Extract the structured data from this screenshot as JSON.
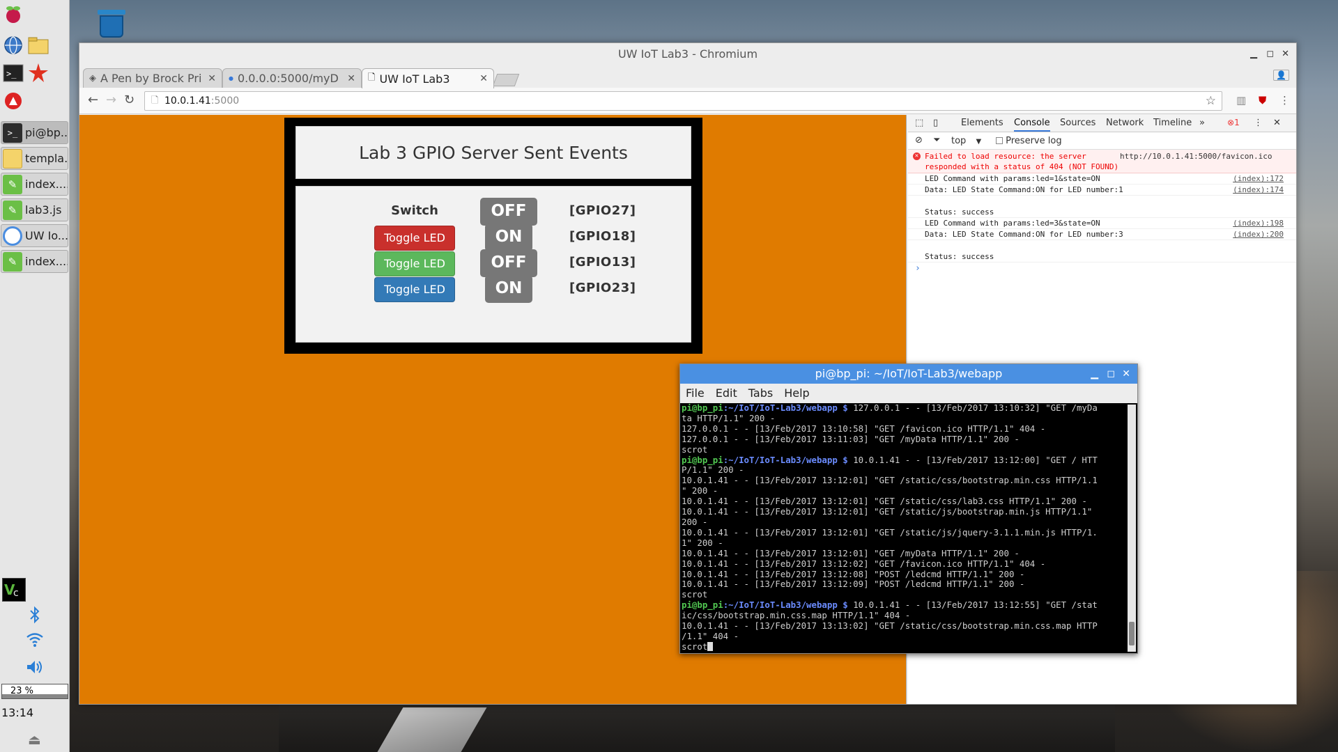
{
  "browser": {
    "window_title": "UW IoT Lab3 - Chromium",
    "tabs": [
      {
        "label": "A Pen by Brock Pri"
      },
      {
        "label": "0.0.0.0:5000/myD"
      },
      {
        "label": "UW IoT Lab3"
      }
    ],
    "url_host": "10.0.1.41",
    "url_port": ":5000"
  },
  "taskbar": {
    "tasks": [
      {
        "label": "pi@bp..."
      },
      {
        "label": "templa..."
      },
      {
        "label": "index...."
      },
      {
        "label": "lab3.js"
      },
      {
        "label": "UW Io..."
      },
      {
        "label": "index...."
      }
    ],
    "cpu": "23 %",
    "clock": "13:14"
  },
  "lab": {
    "title": "Lab 3 GPIO Server Sent Events",
    "switch_label": "Switch",
    "rows": [
      {
        "state": "OFF",
        "gpio": "[GPIO27]"
      },
      {
        "button": "Toggle LED",
        "state": "ON",
        "gpio": "[GPIO18]",
        "color": "#c9302c"
      },
      {
        "button": "Toggle LED",
        "state": "OFF",
        "gpio": "[GPIO13]",
        "color": "#5cb85c"
      },
      {
        "button": "Toggle LED",
        "state": "ON",
        "gpio": "[GPIO23]",
        "color": "#337ab7"
      }
    ]
  },
  "devtools": {
    "tabs": [
      "Elements",
      "Console",
      "Sources",
      "Network",
      "Timeline",
      "»"
    ],
    "error_count": "1",
    "context": "top",
    "preserve_log": "Preserve log",
    "error_text_1": "Failed to load resource: the server",
    "error_text_2": "responded with a status of 404 (NOT FOUND)",
    "error_url": "http://10.0.1.41:5000/favicon.ico",
    "logs": [
      {
        "text": "LED Command with params:led=1&state=ON",
        "src": "(index):172"
      },
      {
        "text": "Data: LED State Command:ON for LED number:1",
        "src": "(index):174"
      },
      {
        "text": "",
        "src": ""
      },
      {
        "text": "Status: success",
        "src": ""
      },
      {
        "text": "LED Command with params:led=3&state=ON",
        "src": "(index):198"
      },
      {
        "text": "Data: LED State Command:ON for LED number:3",
        "src": "(index):200"
      },
      {
        "text": "",
        "src": ""
      },
      {
        "text": "Status: success",
        "src": ""
      }
    ]
  },
  "terminal": {
    "title": "pi@bp_pi: ~/IoT/IoT-Lab3/webapp",
    "menu": [
      "File",
      "Edit",
      "Tabs",
      "Help"
    ],
    "prompt_user": "pi@bp_pi",
    "prompt_path": ":~/IoT/IoT-Lab3/webapp $",
    "lines": [
      {
        "p": true,
        "t": " 127.0.0.1 - - [13/Feb/2017 13:10:32] \"GET /myDa"
      },
      {
        "t": "ta HTTP/1.1\" 200 -"
      },
      {
        "t": "127.0.0.1 - - [13/Feb/2017 13:10:58] \"GET /favicon.ico HTTP/1.1\" 404 -"
      },
      {
        "t": "127.0.0.1 - - [13/Feb/2017 13:11:03] \"GET /myData HTTP/1.1\" 200 -"
      },
      {
        "t": "scrot"
      },
      {
        "p": true,
        "t": " 10.0.1.41 - - [13/Feb/2017 13:12:00] \"GET / HTT"
      },
      {
        "t": "P/1.1\" 200 -"
      },
      {
        "t": "10.0.1.41 - - [13/Feb/2017 13:12:01] \"GET /static/css/bootstrap.min.css HTTP/1.1"
      },
      {
        "t": "\" 200 -"
      },
      {
        "t": "10.0.1.41 - - [13/Feb/2017 13:12:01] \"GET /static/css/lab3.css HTTP/1.1\" 200 -"
      },
      {
        "t": "10.0.1.41 - - [13/Feb/2017 13:12:01] \"GET /static/js/bootstrap.min.js HTTP/1.1\""
      },
      {
        "t": "200 -"
      },
      {
        "t": "10.0.1.41 - - [13/Feb/2017 13:12:01] \"GET /static/js/jquery-3.1.1.min.js HTTP/1."
      },
      {
        "t": "1\" 200 -"
      },
      {
        "t": "10.0.1.41 - - [13/Feb/2017 13:12:01] \"GET /myData HTTP/1.1\" 200 -"
      },
      {
        "t": "10.0.1.41 - - [13/Feb/2017 13:12:02] \"GET /favicon.ico HTTP/1.1\" 404 -"
      },
      {
        "t": "10.0.1.41 - - [13/Feb/2017 13:12:08] \"POST /ledcmd HTTP/1.1\" 200 -"
      },
      {
        "t": "10.0.1.41 - - [13/Feb/2017 13:12:09] \"POST /ledcmd HTTP/1.1\" 200 -"
      },
      {
        "t": "scrot"
      },
      {
        "p": true,
        "t": " 10.0.1.41 - - [13/Feb/2017 13:12:55] \"GET /stat"
      },
      {
        "t": "ic/css/bootstrap.min.css.map HTTP/1.1\" 404 -"
      },
      {
        "t": "10.0.1.41 - - [13/Feb/2017 13:13:02] \"GET /static/css/bootstrap.min.css.map HTTP"
      },
      {
        "t": "/1.1\" 404 -"
      },
      {
        "t": "scrot",
        "cursor": true
      }
    ]
  }
}
